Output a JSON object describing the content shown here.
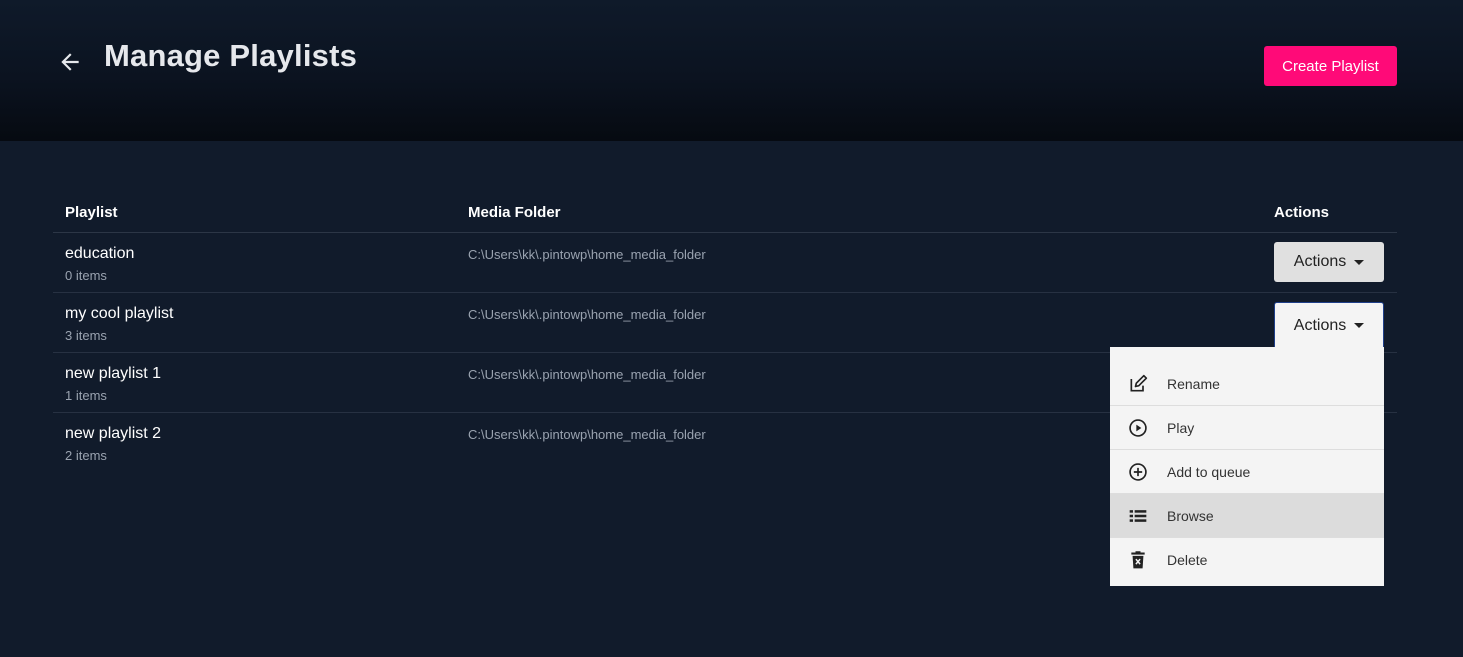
{
  "header": {
    "title": "Manage Playlists",
    "create_label": "Create Playlist",
    "back_icon": "arrow-left-icon"
  },
  "table": {
    "columns": {
      "playlist": "Playlist",
      "media_folder": "Media Folder",
      "actions": "Actions"
    },
    "rows": [
      {
        "name": "education",
        "count": "0 items",
        "folder": "C:\\Users\\kk\\.pintowp\\home_media_folder",
        "action_label": "Actions"
      },
      {
        "name": "my cool playlist",
        "count": "3 items",
        "folder": "C:\\Users\\kk\\.pintowp\\home_media_folder",
        "action_label": "Actions"
      },
      {
        "name": "new playlist 1",
        "count": "1 items",
        "folder": "C:\\Users\\kk\\.pintowp\\home_media_folder",
        "action_label": "Actions"
      },
      {
        "name": "new playlist 2",
        "count": "2 items",
        "folder": "C:\\Users\\kk\\.pintowp\\home_media_folder",
        "action_label": "Actions"
      }
    ]
  },
  "menu": {
    "items": [
      {
        "label": "Rename",
        "icon": "edit-icon"
      },
      {
        "label": "Play",
        "icon": "play-circle-icon"
      },
      {
        "label": "Add to queue",
        "icon": "add-circle-icon"
      },
      {
        "label": "Browse",
        "icon": "list-icon"
      },
      {
        "label": "Delete",
        "icon": "trash-icon"
      }
    ]
  },
  "colors": {
    "background": "#111b2b",
    "accent": "#ff0a78",
    "menu_bg": "#f4f4f4"
  }
}
